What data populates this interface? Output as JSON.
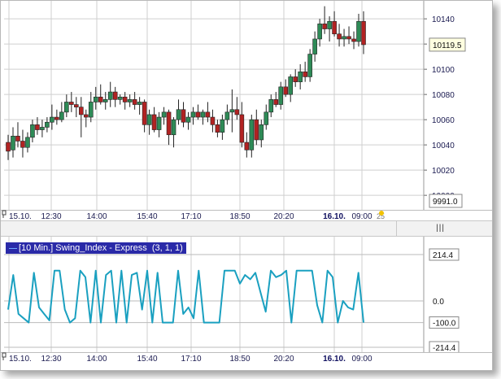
{
  "chart_data": [
    {
      "type": "candlestick",
      "title": "",
      "x": [
        "15.10.",
        "12:30",
        "14:00",
        "15:40",
        "17:10",
        "18:50",
        "20:20",
        "16.10.",
        "09:00"
      ],
      "y_ticks": [
        "10140",
        "10120",
        "10100",
        "10080",
        "10060",
        "10040",
        "10020",
        "10000"
      ],
      "ylim": [
        9993,
        10153
      ],
      "last_price_label": "10119.5",
      "lower_value_label": "9991.0",
      "axis_marker": "25",
      "grid": true,
      "candles": [
        [
          10042,
          10048,
          10028,
          10035
        ],
        [
          10036,
          10054,
          10030,
          10047
        ],
        [
          10047,
          10058,
          10038,
          10043
        ],
        [
          10043,
          10052,
          10030,
          10038
        ],
        [
          10038,
          10050,
          10034,
          10046
        ],
        [
          10046,
          10060,
          10042,
          10056
        ],
        [
          10056,
          10062,
          10048,
          10052
        ],
        [
          10052,
          10060,
          10046,
          10054
        ],
        [
          10054,
          10062,
          10050,
          10058
        ],
        [
          10058,
          10072,
          10052,
          10062
        ],
        [
          10062,
          10068,
          10056,
          10060
        ],
        [
          10060,
          10074,
          10058,
          10066
        ],
        [
          10066,
          10080,
          10062,
          10074
        ],
        [
          10074,
          10082,
          10066,
          10072
        ],
        [
          10072,
          10078,
          10062,
          10070
        ],
        [
          10070,
          10078,
          10046,
          10064
        ],
        [
          10064,
          10068,
          10054,
          10062
        ],
        [
          10062,
          10082,
          10058,
          10074
        ],
        [
          10074,
          10086,
          10068,
          10078
        ],
        [
          10078,
          10088,
          10072,
          10074
        ],
        [
          10074,
          10082,
          10068,
          10076
        ],
        [
          10076,
          10090,
          10070,
          10082
        ],
        [
          10082,
          10086,
          10070,
          10076
        ],
        [
          10076,
          10080,
          10072,
          10078
        ],
        [
          10078,
          10082,
          10068,
          10074
        ],
        [
          10074,
          10080,
          10070,
          10076
        ],
        [
          10076,
          10082,
          10068,
          10072
        ],
        [
          10072,
          10078,
          10064,
          10074
        ],
        [
          10074,
          10076,
          10050,
          10056
        ],
        [
          10056,
          10068,
          10048,
          10064
        ],
        [
          10064,
          10070,
          10050,
          10052
        ],
        [
          10052,
          10066,
          10046,
          10062
        ],
        [
          10062,
          10070,
          10056,
          10066
        ],
        [
          10066,
          10068,
          10040,
          10048
        ],
        [
          10048,
          10062,
          10038,
          10060
        ],
        [
          10060,
          10076,
          10056,
          10068
        ],
        [
          10068,
          10074,
          10054,
          10058
        ],
        [
          10058,
          10066,
          10052,
          10062
        ],
        [
          10062,
          10070,
          10056,
          10066
        ],
        [
          10066,
          10072,
          10060,
          10062
        ],
        [
          10062,
          10068,
          10056,
          10066
        ],
        [
          10066,
          10074,
          10058,
          10062
        ],
        [
          10062,
          10068,
          10050,
          10056
        ],
        [
          10056,
          10060,
          10046,
          10050
        ],
        [
          10050,
          10064,
          10044,
          10060
        ],
        [
          10060,
          10072,
          10056,
          10066
        ],
        [
          10066,
          10084,
          10050,
          10068
        ],
        [
          10068,
          10078,
          10060,
          10064
        ],
        [
          10064,
          10074,
          10038,
          10042
        ],
        [
          10042,
          10050,
          10030,
          10036
        ],
        [
          10036,
          10064,
          10030,
          10060
        ],
        [
          10060,
          10068,
          10040,
          10044
        ],
        [
          10044,
          10060,
          10038,
          10056
        ],
        [
          10056,
          10072,
          10052,
          10066
        ],
        [
          10066,
          10080,
          10062,
          10076
        ],
        [
          10076,
          10082,
          10070,
          10072
        ],
        [
          10072,
          10090,
          10068,
          10086
        ],
        [
          10086,
          10092,
          10078,
          10080
        ],
        [
          10080,
          10096,
          10074,
          10094
        ],
        [
          10094,
          10100,
          10086,
          10090
        ],
        [
          10090,
          10104,
          10084,
          10098
        ],
        [
          10098,
          10106,
          10090,
          10094
        ],
        [
          10094,
          10116,
          10090,
          10112
        ],
        [
          10112,
          10130,
          10106,
          10124
        ],
        [
          10124,
          10140,
          10118,
          10136
        ],
        [
          10136,
          10150,
          10128,
          10132
        ],
        [
          10132,
          10142,
          10122,
          10138
        ],
        [
          10138,
          10146,
          10126,
          10128
        ],
        [
          10128,
          10136,
          10118,
          10124
        ],
        [
          10124,
          10132,
          10118,
          10126
        ],
        [
          10126,
          10134,
          10120,
          10124
        ],
        [
          10124,
          10130,
          10116,
          10122
        ],
        [
          10122,
          10144,
          10118,
          10138
        ],
        [
          10138,
          10146,
          10112,
          10119.5
        ]
      ]
    },
    {
      "type": "line",
      "title": "[10 Min.] Swing_Index - Express  (3, 1, 1)",
      "x": [
        "15.10.",
        "12:30",
        "14:00",
        "15:40",
        "17:10",
        "18:50",
        "20:20",
        "16.10.",
        "09:00"
      ],
      "y_labels": [
        "214.4",
        "0.0",
        "-100.0",
        "-214.4"
      ],
      "ylim": [
        -214.4,
        214.4
      ],
      "series": [
        {
          "values": [
            -40,
            120,
            -60,
            -80,
            -100,
            130,
            -30,
            -60,
            -90,
            140,
            140,
            -40,
            -100,
            -80,
            140,
            110,
            -100,
            140,
            -100,
            120,
            140,
            -100,
            140,
            -100,
            120,
            130,
            -40,
            140,
            -100,
            130,
            -100,
            -100,
            -100,
            140,
            -60,
            -30,
            -80,
            140,
            -100,
            -100,
            -100,
            -100,
            140,
            140,
            140,
            80,
            120,
            100,
            130,
            40,
            -50,
            140,
            110,
            120,
            140,
            -100,
            140,
            140,
            140,
            140,
            -20,
            -100,
            140,
            110,
            -100,
            0,
            -30,
            -40,
            130,
            -100
          ]
        }
      ]
    }
  ],
  "colors": {
    "up_candle": "#2e8b57",
    "down_candle": "#b22222",
    "indicator_line": "#1aa0c0",
    "grid": "#cfcfcf",
    "axis_text": "#1a1a50",
    "title_bg": "#2a2aa8"
  },
  "scroll_grip": "|||"
}
